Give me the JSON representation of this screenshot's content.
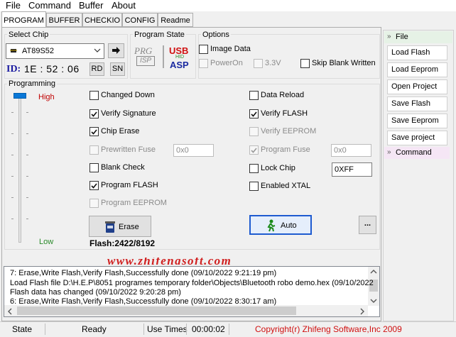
{
  "menu": [
    "File",
    "Command",
    "Buffer",
    "About"
  ],
  "tabs": [
    "PROGRAM",
    "BUFFER",
    "CHECKIO",
    "CONFIG",
    "Readme"
  ],
  "select_chip": {
    "title": "Select Chip",
    "chip": "AT89S52",
    "id_label": "ID:",
    "id_value": "1E : 52 : 06",
    "rd_label": "RD",
    "sn_label": "SN"
  },
  "program_state": {
    "title": "Program State",
    "prg_logo": "PRG",
    "isp_logo": "ISP",
    "usb_logo": "USB",
    "hid_logo": "HID",
    "asp_logo": "ASP"
  },
  "options": {
    "title": "Options",
    "image_data": "Image Data",
    "power_on": "PowerOn",
    "v33": "3.3V",
    "skip_blank": "Skip Blank Written"
  },
  "programming": {
    "title": "Programming",
    "high": "High",
    "low": "Low",
    "items_left": [
      {
        "label": "Changed Down",
        "checked": false,
        "disabled": false
      },
      {
        "label": "Verify Signature",
        "checked": true,
        "disabled": false
      },
      {
        "label": "Chip Erase",
        "checked": true,
        "disabled": false
      },
      {
        "label": "Prewritten Fuse",
        "checked": false,
        "disabled": true
      },
      {
        "label": "Blank Check",
        "checked": false,
        "disabled": false
      },
      {
        "label": "Program FLASH",
        "checked": true,
        "disabled": false
      },
      {
        "label": "Program EEPROM",
        "checked": false,
        "disabled": true
      }
    ],
    "items_right": [
      {
        "label": "Data Reload",
        "checked": false,
        "disabled": false
      },
      {
        "label": "Verify FLASH",
        "checked": true,
        "disabled": false
      },
      {
        "label": "Verify EEPROM",
        "checked": false,
        "disabled": true
      },
      {
        "label": "Program Fuse",
        "checked": true,
        "disabled": true
      },
      {
        "label": "Lock Chip",
        "checked": false,
        "disabled": false
      },
      {
        "label": "Enabled XTAL",
        "checked": false,
        "disabled": false
      }
    ],
    "prewritten_fuse_value": "0x0",
    "program_fuse_value": "0x0",
    "lock_chip_value": "0XFF",
    "erase_label": "Erase",
    "auto_label": "Auto",
    "more_label": "...",
    "flash_info": "Flash:2422/8192"
  },
  "watermark": "www.zhifengsoft.com",
  "log": [
    "7: Erase,Write Flash,Verify Flash,Successfully done (09/10/2022 9:21:19 pm)",
    "Load Flash file D:\\H.E.P\\8051 programes temporary folder\\Objects\\Bluetooth robo demo.hex (09/10/2022",
    "Flash data has changed (09/10/2022 9:20:28 pm)",
    "6: Erase,Write Flash,Verify Flash,Successfully done (09/10/2022 8:30:17 am)"
  ],
  "sidebar": {
    "file_header": "File",
    "buttons": [
      "Load Flash",
      "Load Eeprom",
      "Open Project",
      "Save Flash",
      "Save Eeprom",
      "Save project"
    ],
    "command_header": "Command"
  },
  "status": {
    "state_label": "State",
    "state_value": "Ready",
    "use_times_label": "Use Times",
    "use_times_value": "00:00:02",
    "copyright": "Copyright(r) Zhifeng Software,Inc 2009"
  }
}
